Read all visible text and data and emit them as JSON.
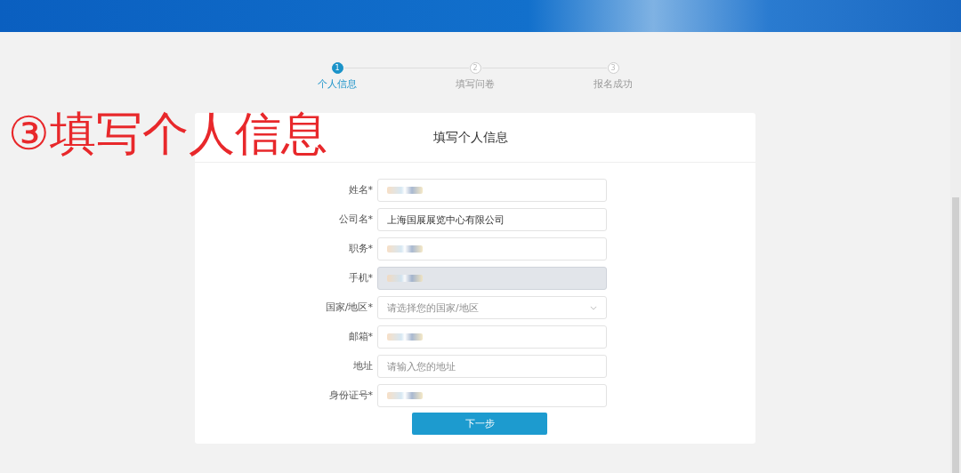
{
  "steps": [
    {
      "number": "1",
      "label": "个人信息",
      "selected": true
    },
    {
      "number": "2",
      "label": "填写问卷",
      "selected": false
    },
    {
      "number": "3",
      "label": "报名成功",
      "selected": false
    }
  ],
  "annotation": "③填写个人信息",
  "form": {
    "title": "填写个人信息",
    "fields": [
      {
        "label": "姓名*",
        "kind": "text",
        "obscured": true,
        "disabled": false
      },
      {
        "label": "公司名*",
        "kind": "text",
        "value": "上海国展展览中心有限公司",
        "obscured": false,
        "disabled": false
      },
      {
        "label": "职务*",
        "kind": "text",
        "obscured": true,
        "disabled": false
      },
      {
        "label": "手机*",
        "kind": "text",
        "obscured": true,
        "disabled": true
      },
      {
        "label": "国家/地区*",
        "kind": "select",
        "placeholder": "请选择您的国家/地区",
        "disabled": false
      },
      {
        "label": "邮箱*",
        "kind": "text",
        "obscured": true,
        "disabled": false
      },
      {
        "label": "地址",
        "kind": "text",
        "placeholder": "请输入您的地址",
        "obscured": false,
        "disabled": false
      },
      {
        "label": "身份证号*",
        "kind": "text",
        "obscured": true,
        "disabled": false
      }
    ],
    "submit": "下一步"
  }
}
